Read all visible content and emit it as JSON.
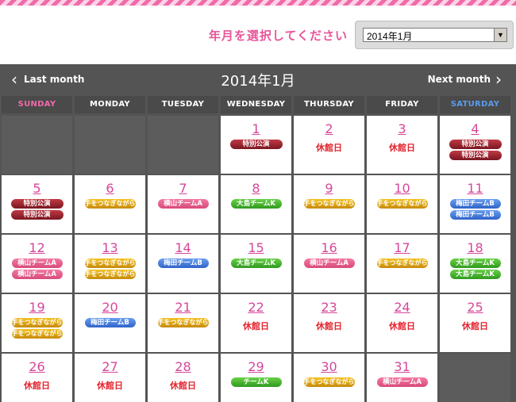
{
  "selector": {
    "label": "年月を選択してください",
    "selected": "2014年1月"
  },
  "calendar": {
    "prev_label": "Last month",
    "next_label": "Next month",
    "title": "2014年1月",
    "weekdays": [
      {
        "label": "SUNDAY",
        "color": "#f06aa8"
      },
      {
        "label": "MONDAY",
        "color": "#ffffff"
      },
      {
        "label": "TUESDAY",
        "color": "#ffffff"
      },
      {
        "label": "WEDNESDAY",
        "color": "#ffffff"
      },
      {
        "label": "THURSDAY",
        "color": "#ffffff"
      },
      {
        "label": "FRIDAY",
        "color": "#ffffff"
      },
      {
        "label": "SATURDAY",
        "color": "#5b9bea"
      }
    ],
    "weeks": [
      [
        null,
        null,
        null,
        {
          "day": "1",
          "events": [
            {
              "label": "特別公演",
              "color": "darkred"
            }
          ]
        },
        {
          "day": "2",
          "closed": "休館日"
        },
        {
          "day": "3",
          "closed": "休館日"
        },
        {
          "day": "4",
          "events": [
            {
              "label": "特別公演",
              "color": "darkred"
            },
            {
              "label": "特別公演",
              "color": "darkred"
            }
          ]
        }
      ],
      [
        {
          "day": "5",
          "events": [
            {
              "label": "特別公演",
              "color": "darkred"
            },
            {
              "label": "特別公演",
              "color": "darkred"
            }
          ]
        },
        {
          "day": "6",
          "events": [
            {
              "label": "手をつなぎながら",
              "color": "yellow"
            }
          ]
        },
        {
          "day": "7",
          "events": [
            {
              "label": "横山チームA",
              "color": "pink"
            }
          ]
        },
        {
          "day": "8",
          "events": [
            {
              "label": "大島チームK",
              "color": "green"
            }
          ]
        },
        {
          "day": "9",
          "events": [
            {
              "label": "手をつなぎながら",
              "color": "yellow"
            }
          ]
        },
        {
          "day": "10",
          "events": [
            {
              "label": "手をつなぎながら",
              "color": "yellow"
            }
          ]
        },
        {
          "day": "11",
          "events": [
            {
              "label": "梅田チームB",
              "color": "blue"
            },
            {
              "label": "梅田チームB",
              "color": "blue"
            }
          ]
        }
      ],
      [
        {
          "day": "12",
          "events": [
            {
              "label": "横山チームA",
              "color": "pink"
            },
            {
              "label": "横山チームA",
              "color": "pink"
            }
          ]
        },
        {
          "day": "13",
          "events": [
            {
              "label": "手をつなぎながら",
              "color": "yellow"
            },
            {
              "label": "手をつなぎながら",
              "color": "yellow"
            }
          ]
        },
        {
          "day": "14",
          "events": [
            {
              "label": "梅田チームB",
              "color": "blue"
            }
          ]
        },
        {
          "day": "15",
          "events": [
            {
              "label": "大島チームK",
              "color": "green"
            }
          ]
        },
        {
          "day": "16",
          "events": [
            {
              "label": "横山チームA",
              "color": "pink"
            }
          ]
        },
        {
          "day": "17",
          "events": [
            {
              "label": "手をつなぎながら",
              "color": "yellow"
            }
          ]
        },
        {
          "day": "18",
          "events": [
            {
              "label": "大島チームK",
              "color": "green"
            },
            {
              "label": "大島チームK",
              "color": "green"
            }
          ]
        }
      ],
      [
        {
          "day": "19",
          "events": [
            {
              "label": "手をつなぎながら",
              "color": "yellow"
            },
            {
              "label": "手をつなぎながら",
              "color": "yellow"
            }
          ]
        },
        {
          "day": "20",
          "events": [
            {
              "label": "梅田チームB",
              "color": "blue"
            }
          ]
        },
        {
          "day": "21",
          "events": [
            {
              "label": "手をつなぎながら",
              "color": "yellow"
            }
          ]
        },
        {
          "day": "22",
          "closed": "休館日"
        },
        {
          "day": "23",
          "closed": "休館日"
        },
        {
          "day": "24",
          "closed": "休館日"
        },
        {
          "day": "25",
          "closed": "休館日"
        }
      ],
      [
        {
          "day": "26",
          "closed": "休館日"
        },
        {
          "day": "27",
          "closed": "休館日"
        },
        {
          "day": "28",
          "closed": "休館日"
        },
        {
          "day": "29",
          "events": [
            {
              "label": "チームK",
              "color": "green"
            }
          ]
        },
        {
          "day": "30",
          "events": [
            {
              "label": "手をつなぎながら",
              "color": "yellow"
            }
          ]
        },
        {
          "day": "31",
          "events": [
            {
              "label": "横山チームA",
              "color": "pink"
            }
          ]
        },
        null
      ]
    ]
  }
}
